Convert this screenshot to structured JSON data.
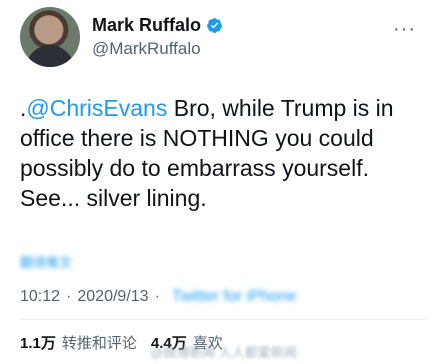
{
  "user": {
    "display_name": "Mark Ruffalo",
    "handle": "@MarkRuffalo",
    "verified": true
  },
  "icons": {
    "verified": "verified-badge-icon",
    "more": "more-horizontal-icon"
  },
  "more_glyph": "···",
  "tweet": {
    "prefix": ".",
    "mention": "@ChrisEvans",
    "body": " Bro, while Trump is in office there is NOTHING you could possibly do to embarrass yourself. See... silver lining."
  },
  "translate_link": "翻译推文",
  "meta": {
    "time": "10:12",
    "separator": "·",
    "date": "2020/9/13",
    "source": "Twitter for iPhone"
  },
  "stats": {
    "retweets_count": "1.1万",
    "retweets_label": "转推和评论",
    "likes_count": "4.4万",
    "likes_label": "喜欢"
  },
  "watermark": "@微博新闻 人人都爱新闻",
  "colors": {
    "accent": "#1d9bf0",
    "text": "#0f1419",
    "muted": "#536471"
  }
}
